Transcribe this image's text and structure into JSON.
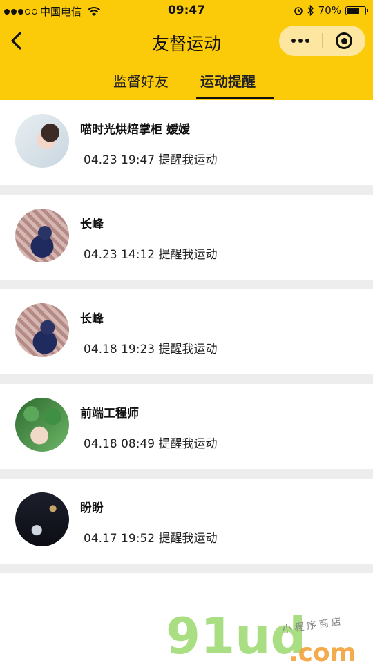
{
  "status_bar": {
    "carrier": "中国电信",
    "time": "09:47",
    "battery_percent": "70%",
    "battery_level": 0.7,
    "signal_bars_filled": 3,
    "signal_bars_total": 5
  },
  "nav": {
    "title": "友督运动",
    "back_icon": "chevron-left-icon",
    "more_icon": "more-dots-icon",
    "close_icon": "target-circle-icon"
  },
  "tabs": [
    {
      "label": "监督好友",
      "active": false
    },
    {
      "label": "运动提醒",
      "active": true
    }
  ],
  "reminders": [
    {
      "name": "喵时光烘焙掌柜 嫒嫒",
      "date": "04.23",
      "time": "19:47",
      "action": "提醒我运动"
    },
    {
      "name": "长峰",
      "date": "04.23",
      "time": "14:12",
      "action": "提醒我运动"
    },
    {
      "name": "长峰",
      "date": "04.18",
      "time": "19:23",
      "action": "提醒我运动"
    },
    {
      "name": "前端工程师",
      "date": "04.18",
      "time": "08:49",
      "action": "提醒我运动"
    },
    {
      "name": "盼盼",
      "date": "04.17",
      "time": "19:52",
      "action": "提醒我运动"
    }
  ],
  "watermark": {
    "brand": "91ud",
    "domain": ".com",
    "subtitle": "小程序商店"
  },
  "colors": {
    "header_bg": "#FBCB0A",
    "separator": "#EDEDED"
  }
}
